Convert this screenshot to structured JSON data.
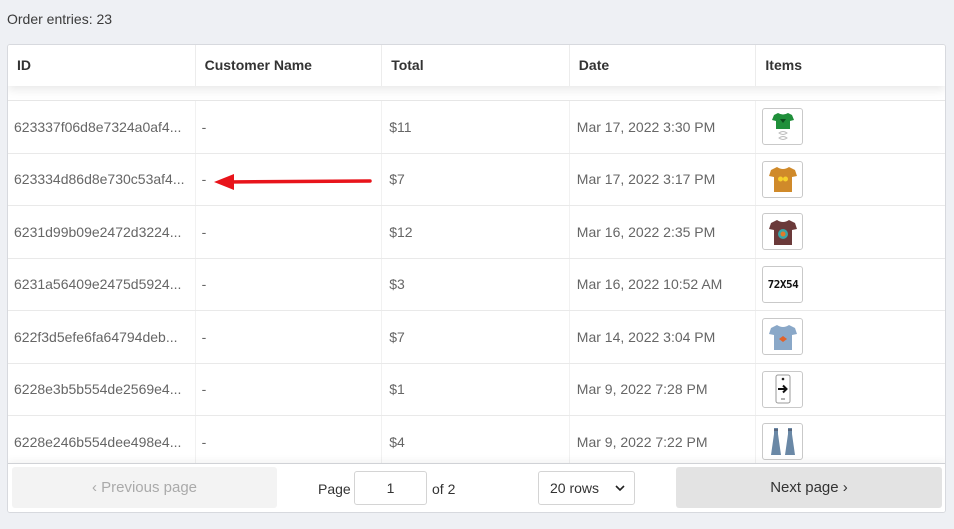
{
  "header": {
    "entries_label": "Order entries: 23"
  },
  "table": {
    "columns": [
      "ID",
      "Customer Name",
      "Total",
      "Date",
      "Items"
    ],
    "rows": [
      {
        "id": "623337f06d8e7324a0af4...",
        "customer": "-",
        "total": "$11",
        "date": "Mar 17, 2022 3:30 PM",
        "item_icon": "green-tshirt-icon"
      },
      {
        "id": "623334d86d8e730c53af4...",
        "customer": "-",
        "total": "$7",
        "date": "Mar 17, 2022 3:17 PM",
        "item_icon": "orange-tshirt-icon"
      },
      {
        "id": "6231d99b09e2472d3224...",
        "customer": "-",
        "total": "$12",
        "date": "Mar 16, 2022 2:35 PM",
        "item_icon": "maroon-tshirt-icon"
      },
      {
        "id": "6231a56409e2475d5924...",
        "customer": "-",
        "total": "$3",
        "date": "Mar 16, 2022 10:52 AM",
        "item_icon": "text-72x54-icon",
        "item_text": "72X54"
      },
      {
        "id": "622f3d5efe6fa64794deb...",
        "customer": "-",
        "total": "$7",
        "date": "Mar 14, 2022 3:04 PM",
        "item_icon": "blue-tshirt-icon"
      },
      {
        "id": "6228e3b5b554de2569e4...",
        "customer": "-",
        "total": "$1",
        "date": "Mar 9, 2022 7:28 PM",
        "item_icon": "arrow-sign-icon"
      },
      {
        "id": "6228e246b554dee498e4...",
        "customer": "-",
        "total": "$4",
        "date": "Mar 9, 2022 7:22 PM",
        "item_icon": "dresses-icon"
      }
    ]
  },
  "pagination": {
    "prev_label": "‹  Previous page",
    "page_label": "Page",
    "page_value": "1",
    "of_label": "of 2",
    "rows_value": "20 rows",
    "next_label": "Next page  ›"
  },
  "annotation": {
    "arrow_color": "#e8141b"
  }
}
